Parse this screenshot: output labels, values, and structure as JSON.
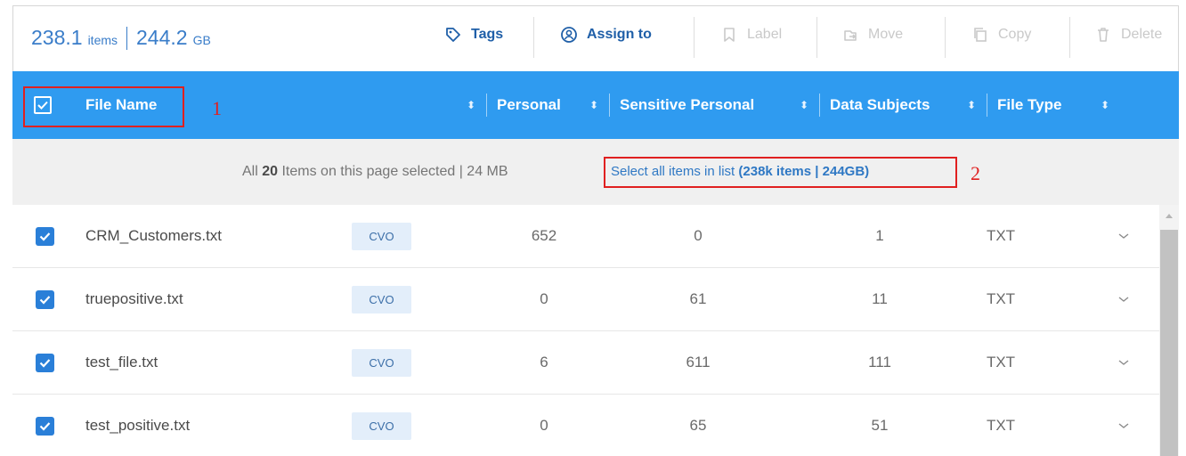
{
  "toolbar": {
    "items_count": "238.1",
    "items_unit": "items",
    "size_count": "244.2",
    "size_unit": "GB",
    "tags_label": "Tags",
    "assign_label": "Assign to",
    "label_label": "Label",
    "move_label": "Move",
    "copy_label": "Copy",
    "delete_label": "Delete"
  },
  "header": {
    "columns": [
      "File Name",
      "Personal",
      "Sensitive Personal",
      "Data Subjects",
      "File Type"
    ],
    "sort_glyph": "⬍"
  },
  "annotations": [
    "1",
    "2"
  ],
  "selection": {
    "prefix": "All ",
    "count": "20",
    "suffix": " Items on this page selected | 24 MB",
    "link_text": "Select all items in list ",
    "link_bold": "(238k items | 244GB)"
  },
  "rows": [
    {
      "name": "CRM_Customers.txt",
      "badge": "CVO",
      "personal": "652",
      "sensitive": "0",
      "subjects": "1",
      "type": "TXT"
    },
    {
      "name": "truepositive.txt",
      "badge": "CVO",
      "personal": "0",
      "sensitive": "61",
      "subjects": "11",
      "type": "TXT"
    },
    {
      "name": "test_file.txt",
      "badge": "CVO",
      "personal": "6",
      "sensitive": "611",
      "subjects": "111",
      "type": "TXT"
    },
    {
      "name": "test_positive.txt",
      "badge": "CVO",
      "personal": "0",
      "sensitive": "65",
      "subjects": "51",
      "type": "TXT"
    }
  ],
  "colors": {
    "header_bg": "#2f9bf0",
    "accent": "#2a7fd8",
    "annotation": "#e02020"
  }
}
